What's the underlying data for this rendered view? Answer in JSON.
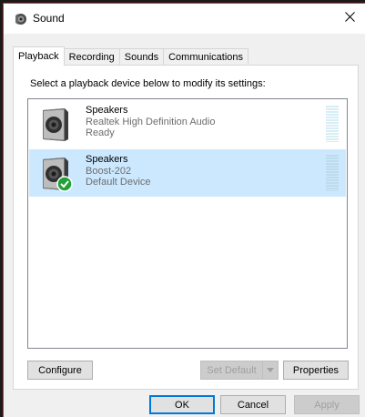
{
  "window": {
    "title": "Sound",
    "icons": {
      "app": "speaker-icon",
      "close": "close-icon"
    }
  },
  "tabs": [
    {
      "label": "Playback",
      "active": true
    },
    {
      "label": "Recording",
      "active": false
    },
    {
      "label": "Sounds",
      "active": false
    },
    {
      "label": "Communications",
      "active": false
    }
  ],
  "playback": {
    "instruction": "Select a playback device below to modify its settings:",
    "devices": [
      {
        "name": "Speakers",
        "description": "Realtek High Definition Audio",
        "status": "Ready",
        "selected": false,
        "is_default": false
      },
      {
        "name": "Speakers",
        "description": "Boost-202",
        "status": "Default Device",
        "selected": true,
        "is_default": true
      }
    ],
    "buttons": {
      "configure": "Configure",
      "set_default": "Set Default",
      "properties": "Properties"
    }
  },
  "footer": {
    "ok": "OK",
    "cancel": "Cancel",
    "apply": "Apply"
  },
  "colors": {
    "selection": "#cce8ff",
    "default_badge": "#21a038",
    "accent_border": "#0078d7"
  }
}
